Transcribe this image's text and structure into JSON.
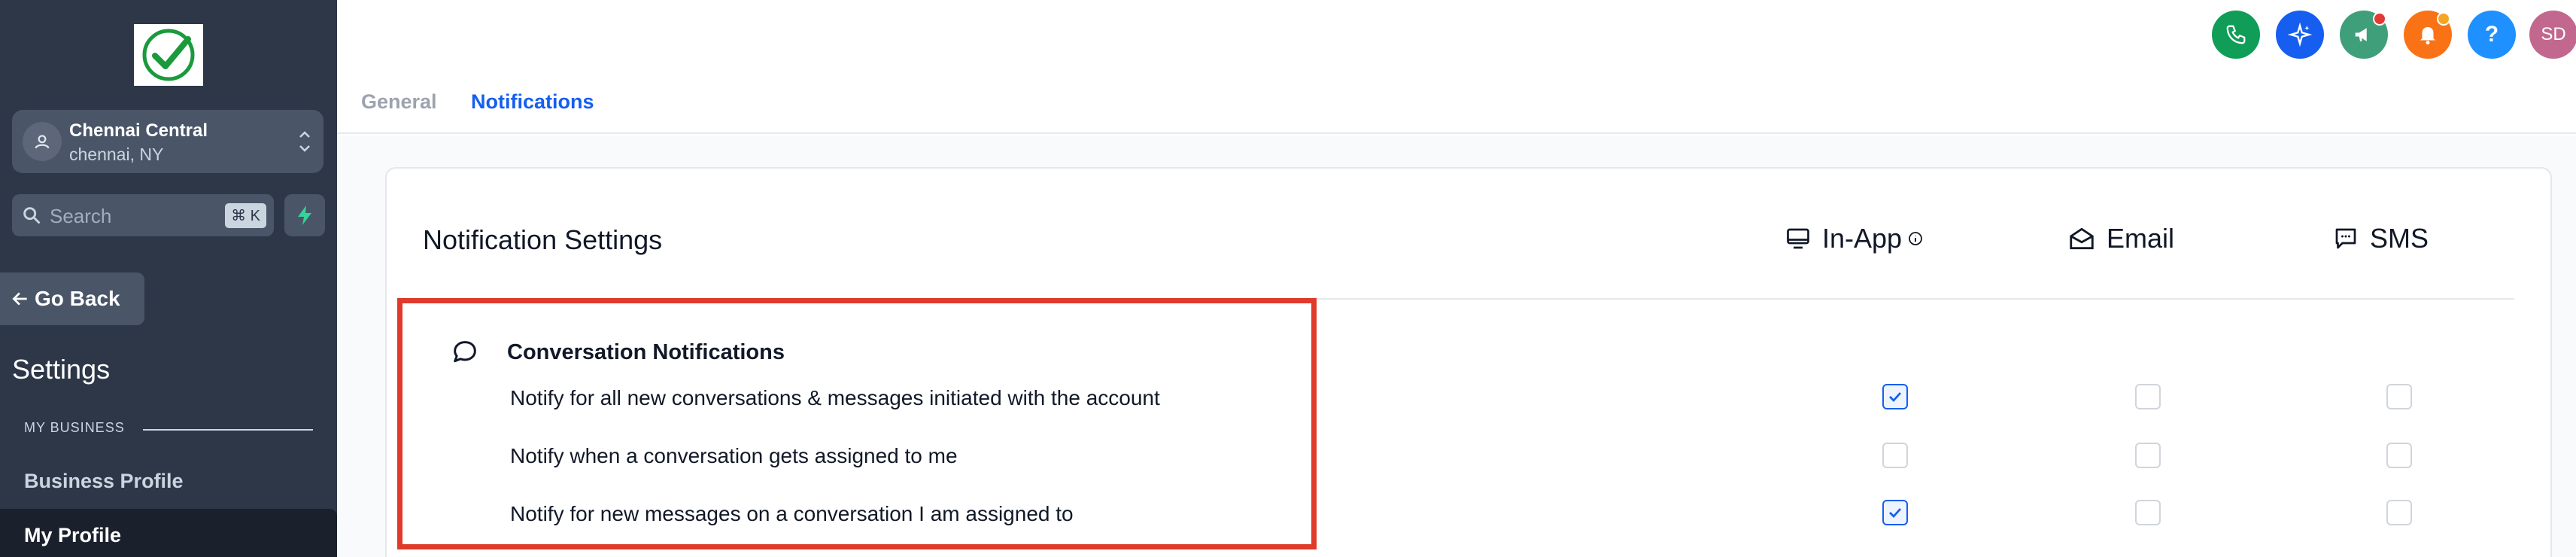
{
  "sidebar": {
    "location": {
      "name": "Chennai Central",
      "city": "chennai, NY"
    },
    "search": {
      "placeholder": "Search",
      "shortcut": "⌘ K"
    },
    "go_back": "Go Back",
    "settings_title": "Settings",
    "section_label": "MY BUSINESS",
    "items": [
      {
        "label": "Business Profile",
        "active": false
      },
      {
        "label": "My Profile",
        "active": true
      }
    ]
  },
  "header": {
    "tabs": [
      {
        "label": "General",
        "active": false
      },
      {
        "label": "Notifications",
        "active": true
      }
    ],
    "icons": [
      {
        "name": "phone-icon",
        "color": "#0f9d58"
      },
      {
        "name": "ai-sparkle-icon",
        "color": "#155eef"
      },
      {
        "name": "megaphone-icon",
        "color": "#3f9f7a",
        "badge_color": "#e53935"
      },
      {
        "name": "bell-icon",
        "color": "#f97316",
        "badge_color": "#f5a623"
      },
      {
        "name": "help-icon",
        "color": "#1e90ff"
      }
    ],
    "avatar_initials": "SD"
  },
  "notification_settings": {
    "title": "Notification Settings",
    "columns": [
      {
        "label": "In-App",
        "icon": "monitor-icon",
        "info": true
      },
      {
        "label": "Email",
        "icon": "mail-open-icon"
      },
      {
        "label": "SMS",
        "icon": "message-square-icon"
      }
    ],
    "group": {
      "title": "Conversation Notifications",
      "icon": "chat-bubble-icon",
      "rows": [
        {
          "label": "Notify for all new conversations & messages initiated with the account",
          "in_app": true,
          "email": false,
          "sms": false
        },
        {
          "label": "Notify when a conversation gets assigned to me",
          "in_app": false,
          "email": false,
          "sms": false
        },
        {
          "label": "Notify for new messages on a conversation I am assigned to",
          "in_app": true,
          "email": false,
          "sms": false
        }
      ]
    }
  },
  "colors": {
    "accent": "#155eef",
    "highlight_box": "#e03a2b",
    "sidebar": "#2d3748"
  }
}
